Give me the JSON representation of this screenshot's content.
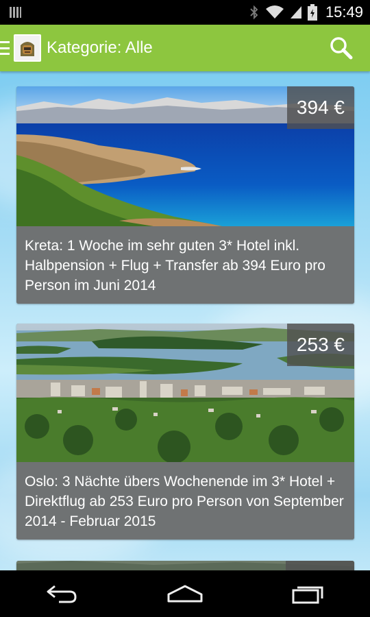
{
  "status_bar": {
    "time": "15:49",
    "icons": [
      "notification-icon",
      "bluetooth-icon",
      "wifi-icon",
      "signal-icon",
      "battery-icon"
    ]
  },
  "app_bar": {
    "title": "Kategorie: Alle",
    "icons": [
      "menu-icon",
      "app-logo",
      "search-icon"
    ],
    "color": "#8dc63f"
  },
  "deals": [
    {
      "price": "394 €",
      "description": "Kreta: 1 Woche im sehr guten 3* Hotel inkl. Halbpension + Flug + Transfer ab 394 Euro pro Person im Juni 2014"
    },
    {
      "price": "253 €",
      "description": "Oslo: 3 Nächte übers Wochenende im 3* Hotel + Direktflug ab 253 Euro pro Person von September 2014 - Februar 2015"
    }
  ],
  "nav_bar": {
    "icons": [
      "back-icon",
      "home-icon",
      "recent-apps-icon"
    ]
  }
}
